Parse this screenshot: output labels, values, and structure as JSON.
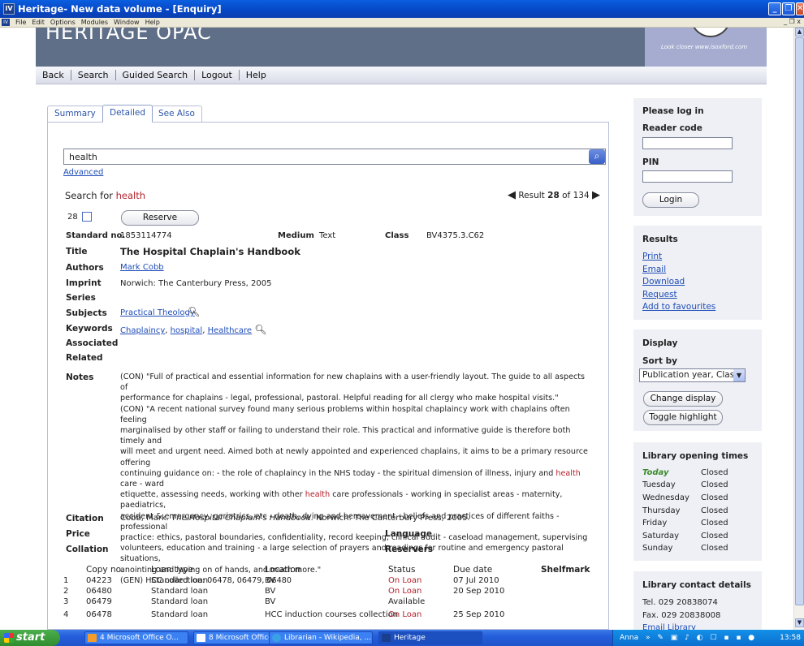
{
  "window": {
    "title": "Heritage- New data volume - [Enquiry]",
    "app_icon": "IV"
  },
  "menu": [
    "File",
    "Edit",
    "Options",
    "Modules",
    "Window",
    "Help"
  ],
  "banner": {
    "brand": "HERITAGE OPAC",
    "promo": "Look closer www.isoxford.com"
  },
  "nav": [
    "Back",
    "Search",
    "Guided Search",
    "Logout",
    "Help"
  ],
  "tabs": [
    "Summary",
    "Detailed",
    "See Also"
  ],
  "search": {
    "value": "health",
    "advanced": "Advanced",
    "search_for_label": "Search for",
    "term": "health"
  },
  "result": {
    "prefix": "Result",
    "current": "28",
    "of": "of",
    "total": "134"
  },
  "record": {
    "number": "28",
    "reserve_label": "Reserve",
    "standard_no_label": "Standard no.",
    "standard_no": "1853114774",
    "medium_label": "Medium",
    "medium": "Text",
    "class_label": "Class",
    "class": "BV4375.3.C62",
    "title_label": "Title",
    "title": "The Hospital Chaplain's Handbook",
    "authors_label": "Authors",
    "author": "Mark Cobb",
    "imprint_label": "Imprint",
    "imprint": "Norwich: The Canterbury Press, 2005",
    "series_label": "Series",
    "subjects_label": "Subjects",
    "subject": "Practical Theology",
    "keywords_label": "Keywords",
    "keyword1": "Chaplaincy",
    "keyword2": "hospital",
    "keyword3": "Healthcare",
    "associated_label": "Associated",
    "related_label": "Related",
    "notes_label": "Notes",
    "notes": [
      "(CON) \"Full of practical and essential information for new chaplains with a user-friendly layout. The guide to all aspects of",
      "performance for chaplains - legal, professional, pastoral. Helpful reading for all clergy who make hospital visits.\"",
      "(CON) \"A recent national survey found many serious problems within hospital chaplaincy work with chaplains often feeling",
      "marginalised by other staff or failing to understand their role. This practical and informative guide is therefore both timely and",
      "will meet and urgent need. Aimed both at newly appointed and experienced chaplains, it aims to be a primary resource offering",
      "continuing guidance on: - the role of chaplaincy in the NHS today - the spiritual dimension of illness, injury and ",
      "health",
      " care - ward",
      "etiquette, assessing needs, working with other ",
      "health",
      " care professionals - working in specialist areas - maternity, paediatrics,",
      "accident & emergency, geriatrics, etc - death, dying and bereavement - beliefs and practices of different faiths - professional",
      "practice: ethics, pastoral boundaries, confidentiality, record keeping, clinical audit - caseload management, supervising",
      "volunteers, education and training - a large selection of prayers and readings for routine and emergency pastoral situations,",
      "anointing and laying on of hands, and much more.\"",
      "(GEN) HCC collection: 06478, 06479, 06480"
    ],
    "citation_label": "Citation",
    "citation_pre": "Cobb, Mark. ",
    "citation_title": "The Hospital Chaplain's Handbook",
    "citation_post": ". Norwich: The Canterbury Press, 2005.",
    "price_label": "Price",
    "language_label": "Language",
    "collation_label": "Collation",
    "reservers_label": "Reservers"
  },
  "copies": {
    "headers": [
      "Copy no.",
      "Loan type",
      "Location",
      "Status",
      "Due date",
      "Shelfmark"
    ],
    "rows": [
      {
        "n": "1",
        "copy": "04223",
        "loan": "Standard loan",
        "loc": "BV",
        "status": "On Loan",
        "due": "07 Jul 2010"
      },
      {
        "n": "2",
        "copy": "06480",
        "loan": "Standard loan",
        "loc": "BV",
        "status": "On Loan",
        "due": "20 Sep 2010"
      },
      {
        "n": "3",
        "copy": "06479",
        "loan": "Standard loan",
        "loc": "BV",
        "status": "Available",
        "due": ""
      },
      {
        "n": "4",
        "copy": "06478",
        "loan": "Standard loan",
        "loc": "HCC induction courses collection",
        "status": "On Loan",
        "due": "25 Sep 2010"
      }
    ]
  },
  "login": {
    "title": "Please log in",
    "reader_code": "Reader code",
    "pin": "PIN",
    "button": "Login"
  },
  "results_box": {
    "title": "Results",
    "links": [
      "Print",
      "Email",
      "Download",
      "Request",
      "Add to favourites"
    ]
  },
  "display": {
    "title": "Display",
    "sort_by": "Sort by",
    "sort_value": "Publication year, Class",
    "change": "Change display",
    "toggle": "Toggle highlight"
  },
  "hours": {
    "title": "Library opening times",
    "days": [
      {
        "day": "Today",
        "val": "Closed"
      },
      {
        "day": "Tuesday",
        "val": "Closed"
      },
      {
        "day": "Wednesday",
        "val": "Closed"
      },
      {
        "day": "Thursday",
        "val": "Closed"
      },
      {
        "day": "Friday",
        "val": "Closed"
      },
      {
        "day": "Saturday",
        "val": "Closed"
      },
      {
        "day": "Sunday",
        "val": "Closed"
      }
    ]
  },
  "contact": {
    "title": "Library contact details",
    "tel": "Tel.  029 20838074",
    "fax": "Fax.  029 20838008",
    "email": "Email Library"
  },
  "taskbar": {
    "start": "start",
    "tasks": [
      "4 Microsoft Office O...",
      "8 Microsoft Office ...",
      "Librarian - Wikipedia, ...",
      "Heritage"
    ],
    "user": "Anna",
    "clock": "13:58"
  },
  "colors": {
    "accent": "#b3212b",
    "link": "#1f4db8",
    "banner": "#5f6f88",
    "today": "#3a8a2a"
  }
}
